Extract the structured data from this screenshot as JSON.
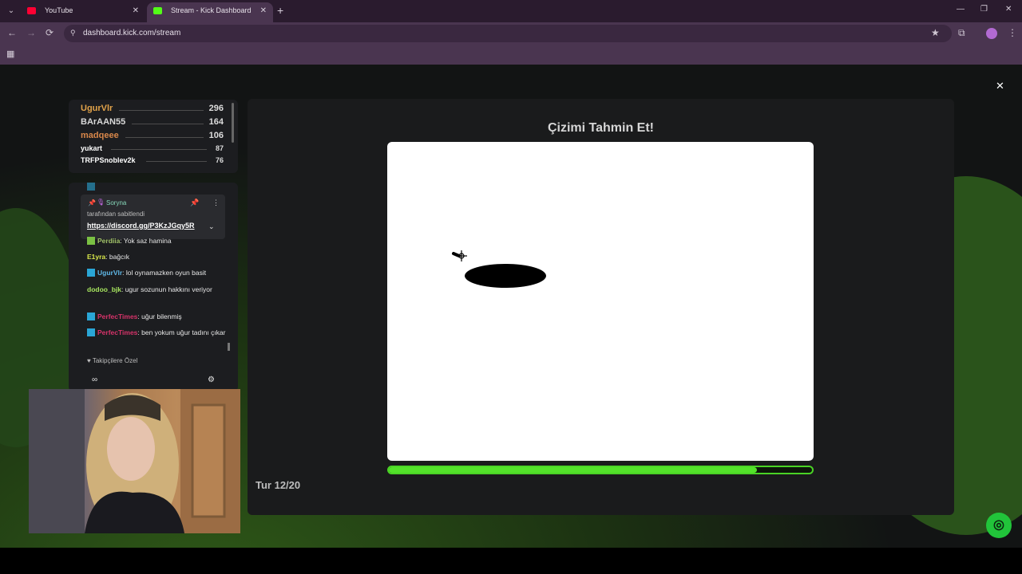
{
  "browser": {
    "tabs": [
      {
        "title": "YouTube",
        "favicon_color": "#ff0033",
        "active": false
      },
      {
        "title": "Stream - Kick Dashboard",
        "favicon_color": "#53fc18",
        "active": true
      }
    ],
    "tab_close_glyph": "✕",
    "new_tab_glyph": "+",
    "window_controls": {
      "minimize": "—",
      "restore": "❐",
      "close": "✕"
    },
    "url": "dashboard.kick.com/stream",
    "nav": {
      "back": "←",
      "forward": "→",
      "reload": "⟳"
    },
    "icons": {
      "site_info": "site-info-icon",
      "star": "★",
      "extensions": "⧉",
      "menu": "⋮",
      "apps": "▦"
    }
  },
  "overlay": {
    "close_glyph": "✕"
  },
  "leaderboard": {
    "rows": [
      {
        "name": "UgurVlr",
        "score": "296",
        "color": "#e2a34a"
      },
      {
        "name": "BArAAN55",
        "score": "164",
        "color": "#d9d9d9"
      },
      {
        "name": "madqeee",
        "score": "106",
        "color": "#d8874a"
      },
      {
        "name": "yukart",
        "score": "87",
        "color": "#ffffff"
      },
      {
        "name": "TRFPSnoblev2k",
        "score": "76",
        "color": "#ffffff"
      }
    ]
  },
  "chat": {
    "pinned": {
      "user": "Soryna",
      "by_text": "tarafından sabitlendi",
      "link": "https://discord.gg/P3KzJGqy5R",
      "pin_glyph": "📌",
      "more_glyph": "⋮",
      "expand_glyph": "⌄"
    },
    "messages": [
      {
        "user": "Perdiia",
        "text": ": Yok saz hamina",
        "user_color": "#a2c36a"
      },
      {
        "user": "E1yra",
        "text": ": bağcık",
        "user_color": "#d9e84a"
      },
      {
        "user": "UgurVlr",
        "text": ": lol oynamazken oyun basit",
        "user_color": "#5fb7e6"
      },
      {
        "user": "dodoo_bjk",
        "text": ": ugur sozunun hakkını veriyor",
        "user_color": "#a7e55f"
      },
      {
        "user": "PerfecTimes",
        "text": ": uğur bilenmiş",
        "user_color": "#d7336a"
      },
      {
        "user": "PerfecTimes",
        "text": ": ben yokum uğur tadını çıkar",
        "user_color": "#d7336a"
      }
    ],
    "follow_only": "♥ Takipçilere Özel",
    "bottom_left": "∞",
    "gear": "⚙"
  },
  "game": {
    "title": "Çizimi Tahmin Et!",
    "round_label": "Tur 12/20",
    "progress_percent": 87
  },
  "help_button_glyph": "🎧"
}
